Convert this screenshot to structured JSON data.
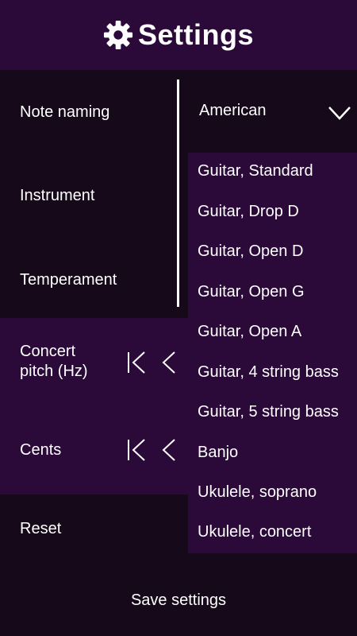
{
  "header": {
    "title": "Settings",
    "icon": "gear-icon"
  },
  "settings": {
    "note_naming_label": "Note naming",
    "instrument_label": "Instrument",
    "temperament_label": "Temperament",
    "concert_pitch_label_line1": "Concert",
    "concert_pitch_label_line2": "pitch (Hz)",
    "cents_label": "Cents",
    "reset_label": "Reset"
  },
  "note_naming": {
    "selected": "American",
    "icon": "chevron-down-icon"
  },
  "instrument_dropdown": {
    "options": [
      "Guitar, Standard",
      "Guitar, Drop D",
      "Guitar, Open D",
      "Guitar, Open G",
      "Guitar, Open A",
      "Guitar, 4 string bass",
      "Guitar, 5 string bass",
      "Banjo",
      "Ukulele, soprano",
      "Ukulele, concert"
    ]
  },
  "footer": {
    "save_label": "Save settings"
  },
  "colors": {
    "header_bg": "#2b0a3a",
    "dark_bg": "#15091a",
    "accent_purple": "#2b0a3a",
    "text": "#ffffff"
  }
}
